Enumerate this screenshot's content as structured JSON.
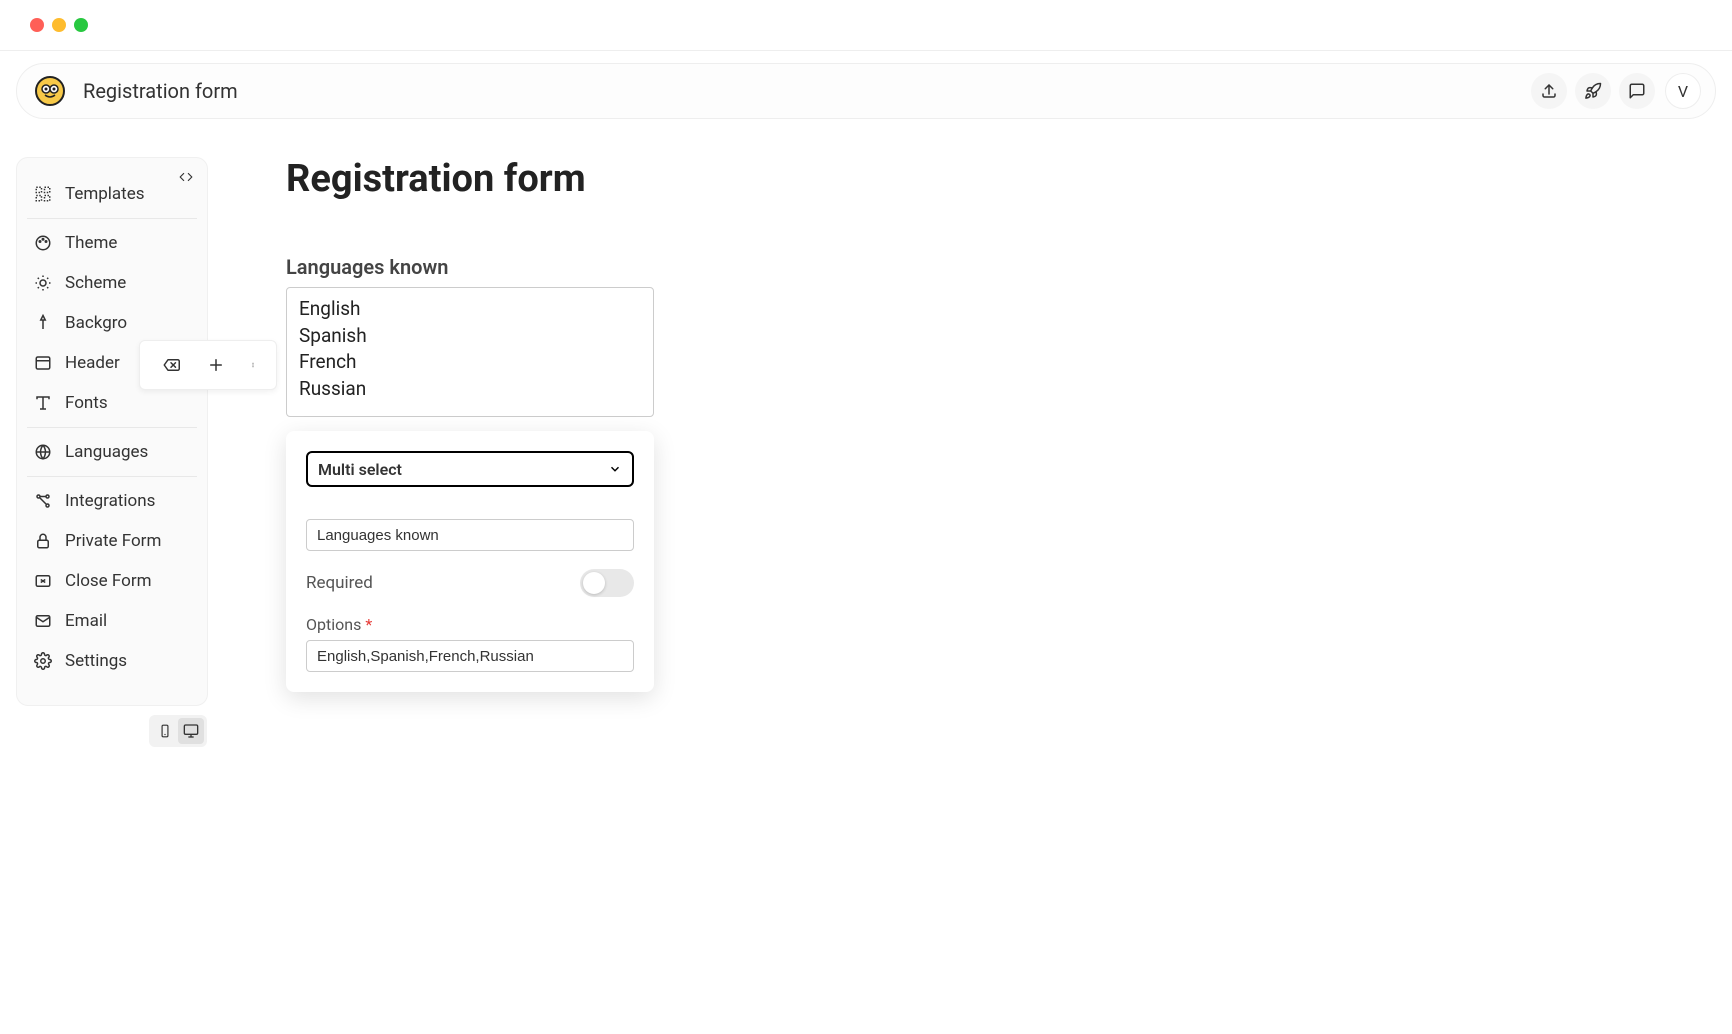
{
  "header": {
    "title": "Registration form",
    "avatar_initial": "V"
  },
  "sidebar": {
    "items": [
      {
        "label": "Templates",
        "icon": "templates"
      },
      {
        "label": "Theme",
        "icon": "palette"
      },
      {
        "label": "Scheme",
        "icon": "sun"
      },
      {
        "label": "Backgro",
        "icon": "pin"
      },
      {
        "label": "Header",
        "icon": "layout"
      },
      {
        "label": "Fonts",
        "icon": "type"
      },
      {
        "label": "Languages",
        "icon": "globe"
      },
      {
        "label": "Integrations",
        "icon": "nodes"
      },
      {
        "label": "Private Form",
        "icon": "lock"
      },
      {
        "label": "Close Form",
        "icon": "close-panel"
      },
      {
        "label": "Email",
        "icon": "mail"
      },
      {
        "label": "Settings",
        "icon": "gear"
      }
    ]
  },
  "form": {
    "title": "Registration form",
    "field_label": "Languages known",
    "options": [
      "English",
      "Spanish",
      "French",
      "Russian"
    ]
  },
  "config": {
    "type_label": "Multi select",
    "name_value": "Languages known",
    "required_label": "Required",
    "required_on": false,
    "options_label": "Options",
    "options_value": "English,Spanish,French,Russian"
  }
}
